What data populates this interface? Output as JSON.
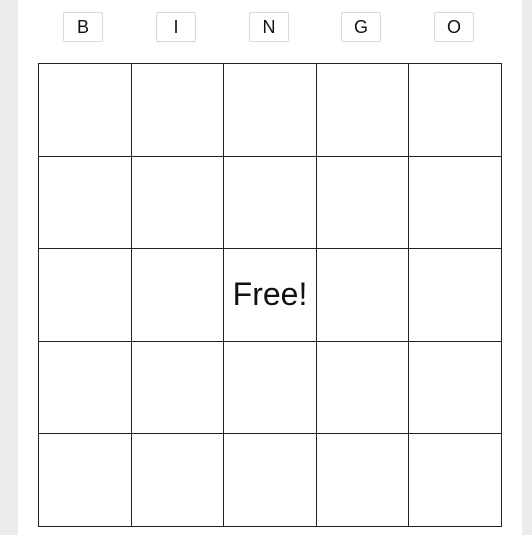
{
  "header": {
    "letters": [
      "B",
      "I",
      "N",
      "G",
      "O"
    ]
  },
  "grid": {
    "rows": [
      [
        "",
        "",
        "",
        "",
        ""
      ],
      [
        "",
        "",
        "",
        "",
        ""
      ],
      [
        "",
        "",
        "Free!",
        "",
        ""
      ],
      [
        "",
        "",
        "",
        "",
        ""
      ],
      [
        "",
        "",
        "",
        "",
        ""
      ]
    ]
  }
}
